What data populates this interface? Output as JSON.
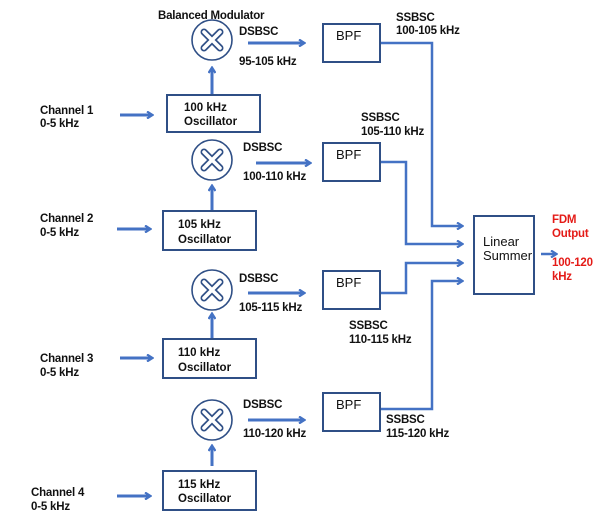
{
  "title_label": "Balanced Modulator",
  "colors": {
    "line": "#4472c4",
    "box_border": "#2f4f86",
    "output_text": "#e41b17"
  },
  "channels": [
    {
      "name": "Channel 1",
      "band": "0-5 kHz",
      "oscillator_freq": "100 kHz",
      "oscillator_label": "Oscillator",
      "modulator_symbol": "multiply-icon",
      "dsbsc_label": "DSBSC",
      "dsbsc_band": "95-105 kHz",
      "filter_label": "BPF",
      "ssbsc_label": "SSBSC",
      "ssbsc_band": "100-105 kHz"
    },
    {
      "name": "Channel 2",
      "band": "0-5 kHz",
      "oscillator_freq": "105 kHz",
      "oscillator_label": "Oscillator",
      "modulator_symbol": "multiply-icon",
      "dsbsc_label": "DSBSC",
      "dsbsc_band": "100-110 kHz",
      "filter_label": "BPF",
      "ssbsc_label": "SSBSC",
      "ssbsc_band": "105-110 kHz"
    },
    {
      "name": "Channel 3",
      "band": "0-5 kHz",
      "oscillator_freq": "110 kHz",
      "oscillator_label": "Oscillator",
      "modulator_symbol": "multiply-icon",
      "dsbsc_label": "DSBSC",
      "dsbsc_band": "105-115 kHz",
      "filter_label": "BPF",
      "ssbsc_label": "SSBSC",
      "ssbsc_band": "110-115 kHz"
    },
    {
      "name": "Channel 4",
      "band": "0-5 kHz",
      "oscillator_freq": "115 kHz",
      "oscillator_label": "Oscillator",
      "modulator_symbol": "multiply-icon",
      "dsbsc_label": "DSBSC",
      "dsbsc_band": "110-120 kHz",
      "filter_label": "BPF",
      "ssbsc_label": "SSBSC",
      "ssbsc_band": "115-120 kHz"
    }
  ],
  "summer": {
    "line1": "Linear",
    "line2": "Summer"
  },
  "output": {
    "line1": "FDM",
    "line2": "Output",
    "band_line1": "100-120",
    "band_line2": "kHz"
  }
}
